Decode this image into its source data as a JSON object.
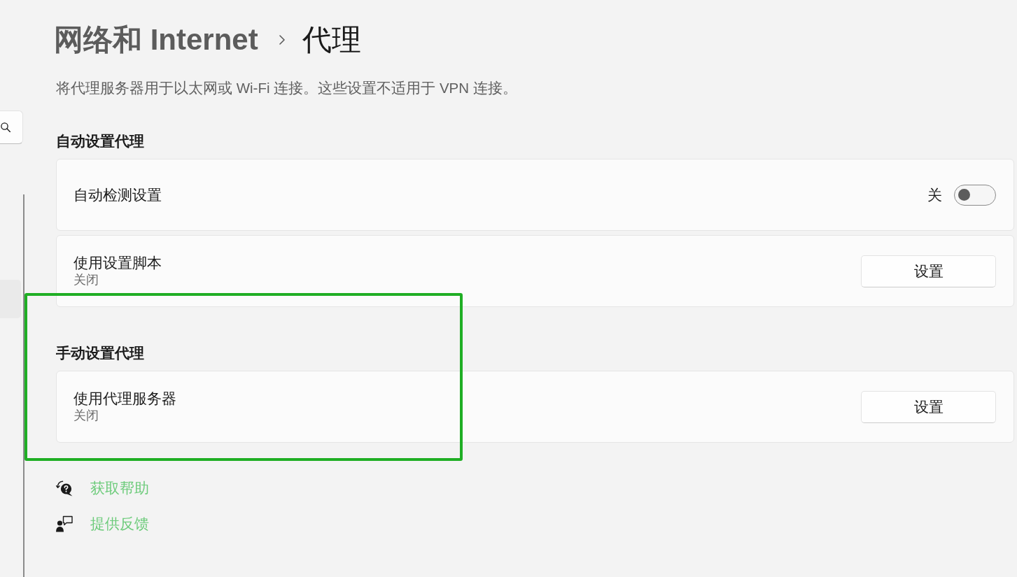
{
  "breadcrumb": [
    {
      "label": "网络和 Internet",
      "current": false
    },
    {
      "label": "代理",
      "current": true
    }
  ],
  "description": "将代理服务器用于以太网或 Wi-Fi 连接。这些设置不适用于 VPN 连接。",
  "sections": [
    {
      "title": "自动设置代理",
      "highlighted": false,
      "rows": [
        {
          "kind": "toggle",
          "label": "自动检测设置",
          "on": false,
          "state_text": "关"
        },
        {
          "kind": "button",
          "label": "使用设置脚本",
          "status": "关闭",
          "button": "设置"
        }
      ]
    },
    {
      "title": "手动设置代理",
      "highlighted": true,
      "rows": [
        {
          "kind": "button",
          "label": "使用代理服务器",
          "status": "关闭",
          "button": "设置"
        }
      ]
    }
  ],
  "links": [
    {
      "kind": "help",
      "label": "获取帮助"
    },
    {
      "kind": "feedback",
      "label": "提供反馈"
    }
  ]
}
